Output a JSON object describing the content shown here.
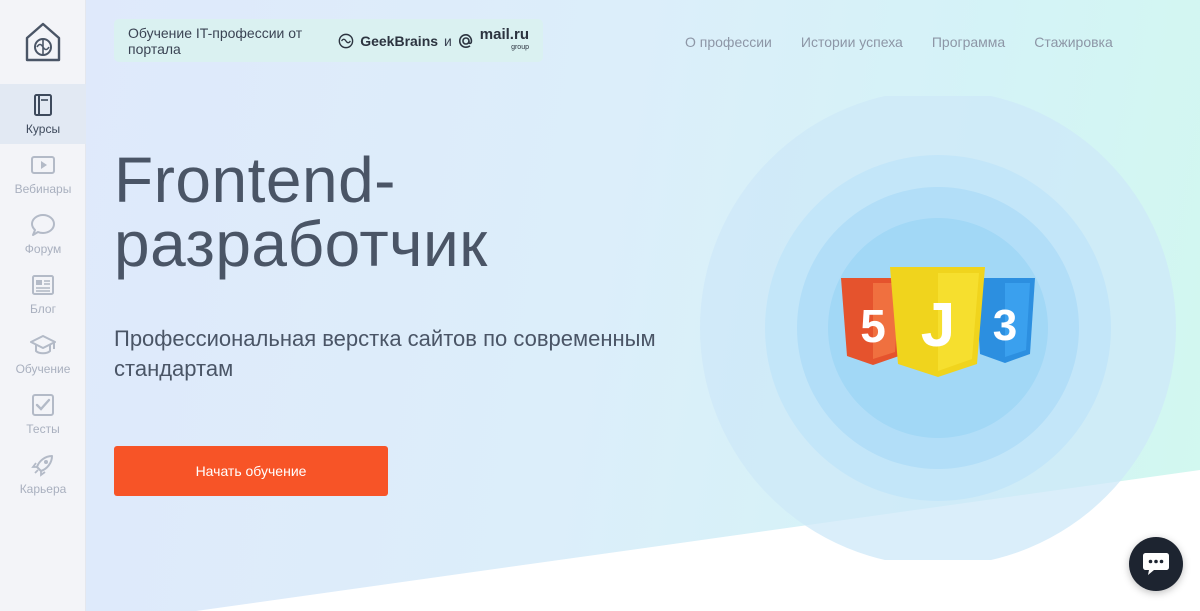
{
  "sidebar": {
    "logo_icon": "brain-house-icon",
    "items": [
      {
        "label": "Курсы",
        "icon": "book-icon",
        "active": true
      },
      {
        "label": "Вебинары",
        "icon": "play-icon"
      },
      {
        "label": "Форум",
        "icon": "chat-bubble-icon"
      },
      {
        "label": "Блог",
        "icon": "newspaper-icon"
      },
      {
        "label": "Обучение",
        "icon": "graduation-cap-icon"
      },
      {
        "label": "Тесты",
        "icon": "checkbox-icon"
      },
      {
        "label": "Карьера",
        "icon": "rocket-icon"
      }
    ]
  },
  "header": {
    "partner_text": "Обучение IT-профессии от портала",
    "geekbrains": "GeekBrains",
    "conj": "и",
    "mailru": "mail.ru",
    "mailru_sub": "group",
    "nav": [
      "О профессии",
      "Истории успеха",
      "Программа",
      "Стажировка"
    ]
  },
  "hero": {
    "title_line1": "Frontend-",
    "title_line2": "разработчик",
    "subtitle": "Профессиональная верстка сайтов по современным стандартам",
    "cta_label": "Начать обучение"
  },
  "badges": {
    "html_glyph": "5",
    "js_glyph": "J",
    "css_glyph": "3"
  },
  "colors": {
    "accent": "#f75427",
    "text": "#4a5566",
    "html": "#e5532d",
    "js": "#f0d41d",
    "css": "#2c8fe0",
    "chat": "#1d2430"
  }
}
